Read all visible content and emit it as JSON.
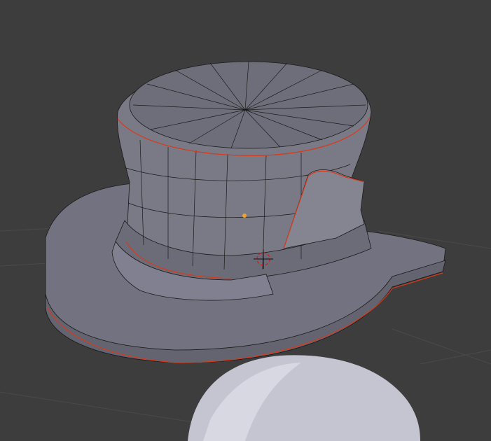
{
  "viewport": {
    "background_color": "#3d3d3d",
    "grid_color": "#4a4a4a",
    "mesh_color": "#7a7a84",
    "mesh_dark_color": "#5f5f68",
    "mesh_light_color": "#8c8c96",
    "edge_color": "#1a1a1a",
    "seam_color": "#d83a1a",
    "head_color": "#c8c8d4",
    "origin_color": "#f0a030",
    "cursor_color": "#d02020"
  }
}
